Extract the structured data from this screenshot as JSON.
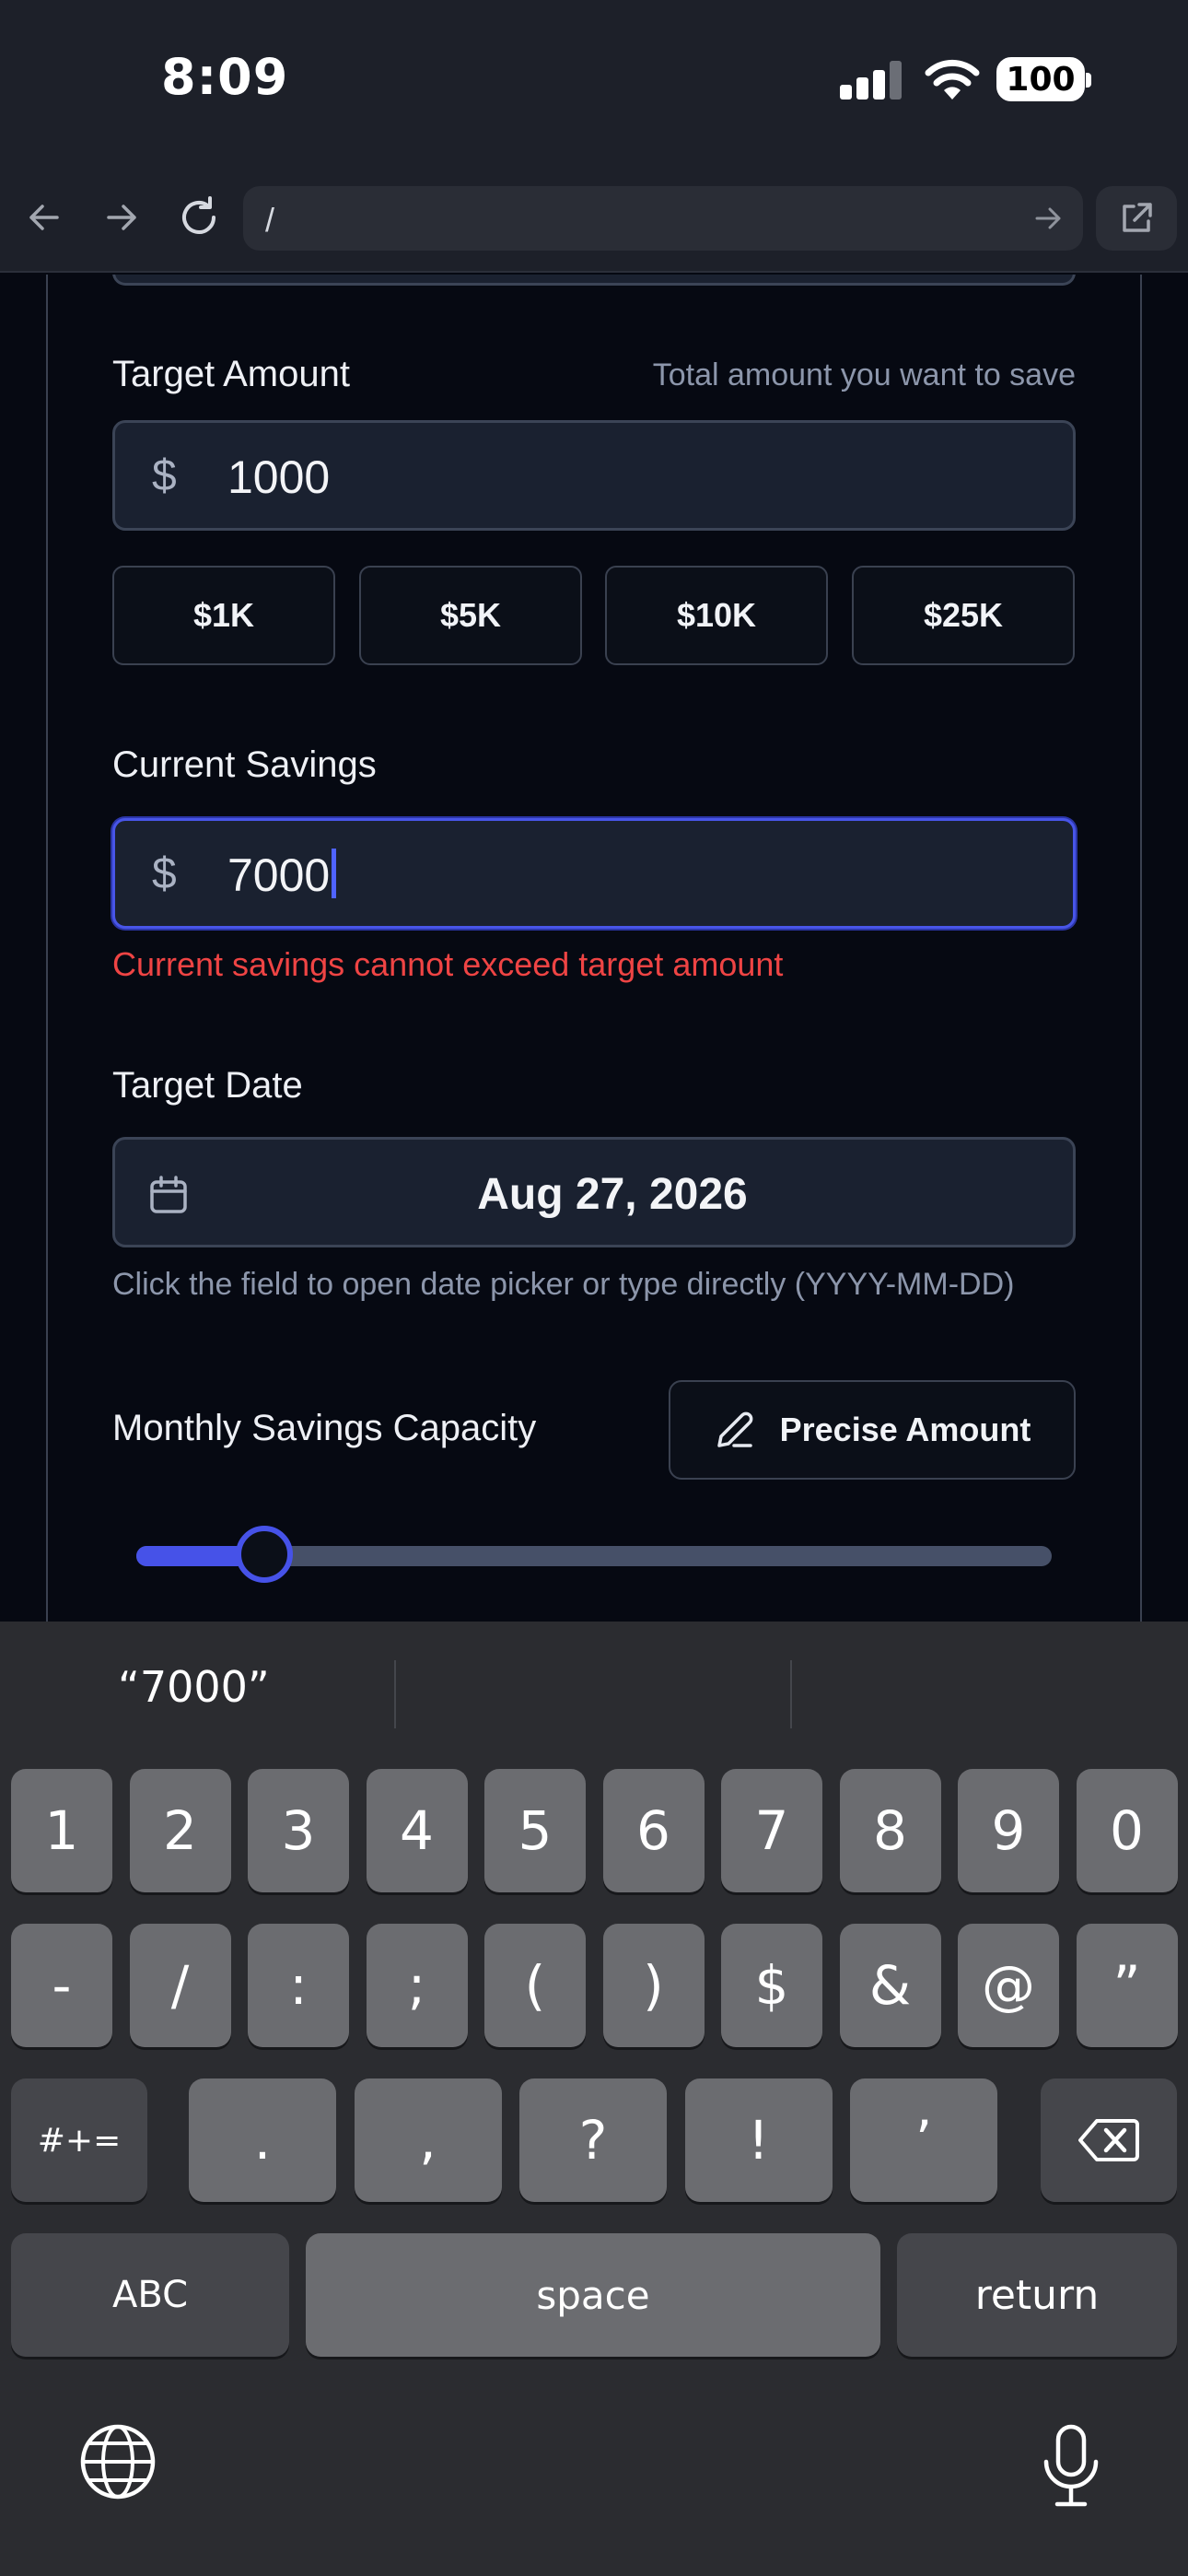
{
  "status_bar": {
    "time": "8:09",
    "battery": "100"
  },
  "browser": {
    "url": "/"
  },
  "form": {
    "target_amount": {
      "label": "Target Amount",
      "hint": "Total amount you want to save",
      "currency_symbol": "$",
      "value": "1000",
      "quick_amounts": [
        "$1K",
        "$5K",
        "$10K",
        "$25K"
      ]
    },
    "current_savings": {
      "label": "Current Savings",
      "currency_symbol": "$",
      "value": "7000",
      "error": "Current savings cannot exceed target amount"
    },
    "target_date": {
      "label": "Target Date",
      "value": "Aug 27, 2026",
      "help": "Click the field to open date picker or type directly (YYYY-MM-DD)"
    },
    "monthly_capacity": {
      "label": "Monthly Savings Capacity",
      "precise_button": "Precise Amount",
      "slider_fraction": 0.14
    }
  },
  "keyboard": {
    "suggestion": "“7000”",
    "row1": [
      "1",
      "2",
      "3",
      "4",
      "5",
      "6",
      "7",
      "8",
      "9",
      "0"
    ],
    "row2": [
      "-",
      "/",
      ":",
      ";",
      "(",
      ")",
      "$",
      "&",
      "@",
      "”"
    ],
    "row3": [
      ".",
      ",",
      "?",
      "!",
      "’"
    ],
    "symbols_key": "#+=",
    "abc_key": "ABC",
    "space_key": "space",
    "return_key": "return"
  },
  "colors": {
    "accent": "#4652e8",
    "error": "#ef4444",
    "background": "#060912",
    "input_bg": "#1a2130"
  }
}
